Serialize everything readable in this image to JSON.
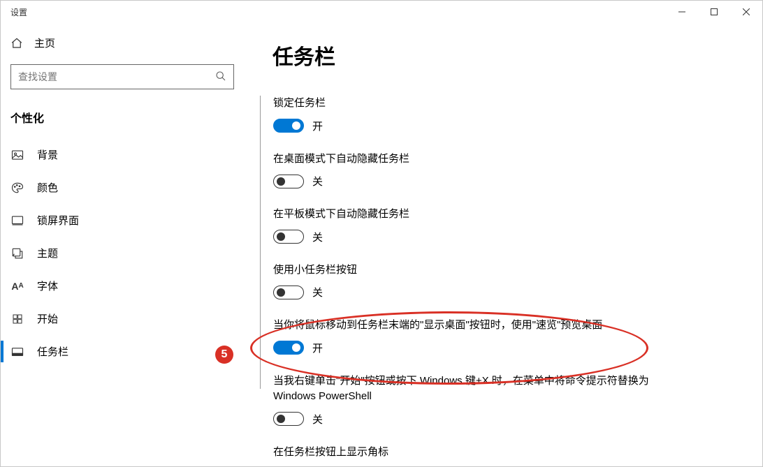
{
  "window": {
    "title": "设置"
  },
  "sidebar": {
    "home_label": "主页",
    "search_placeholder": "查找设置",
    "section_title": "个性化",
    "items": [
      {
        "label": "背景",
        "icon": "picture"
      },
      {
        "label": "颜色",
        "icon": "palette"
      },
      {
        "label": "锁屏界面",
        "icon": "lockscreen"
      },
      {
        "label": "主题",
        "icon": "theme"
      },
      {
        "label": "字体",
        "icon": "font"
      },
      {
        "label": "开始",
        "icon": "start"
      },
      {
        "label": "任务栏",
        "icon": "taskbar",
        "selected": true
      }
    ]
  },
  "content": {
    "heading": "任务栏",
    "state_on": "开",
    "state_off": "关",
    "settings": [
      {
        "label": "锁定任务栏",
        "on": true
      },
      {
        "label": "在桌面模式下自动隐藏任务栏",
        "on": false
      },
      {
        "label": "在平板模式下自动隐藏任务栏",
        "on": false
      },
      {
        "label": "使用小任务栏按钮",
        "on": false
      },
      {
        "label": "当你将鼠标移动到任务栏末端的\"显示桌面\"按钮时，使用\"速览\"预览桌面",
        "on": true
      },
      {
        "label": "当我右键单击\"开始\"按钮或按下 Windows 键+X 时，在菜单中将命令提示符替换为 Windows PowerShell",
        "on": false
      },
      {
        "label": "在任务栏按钮上显示角标",
        "on": null
      }
    ]
  },
  "annotation": {
    "badge": "5"
  }
}
